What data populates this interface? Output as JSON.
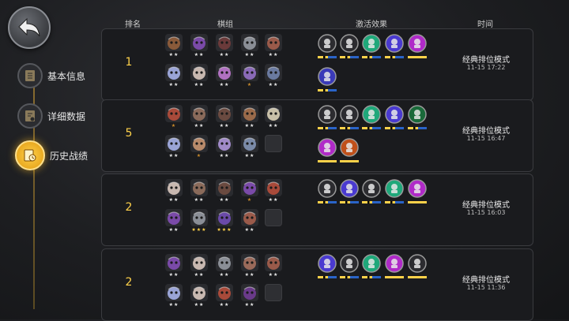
{
  "sidebar": [
    {
      "label": "基本信息",
      "icon": "notebook-icon",
      "active": false
    },
    {
      "label": "详细数据",
      "icon": "document-icon",
      "active": false
    },
    {
      "label": "历史战绩",
      "icon": "history-icon",
      "active": true
    }
  ],
  "headers": {
    "rank": "排名",
    "lineup": "棋组",
    "synergy": "激活效果",
    "time": "时间"
  },
  "colors": {
    "gold": "#ffd24a",
    "blue": "#2a64c8",
    "card_bg": "#1a1b1e"
  },
  "matches": [
    {
      "rank": "1",
      "mode": "经典排位模式",
      "time": "11-15 17:22",
      "heroes": [
        {
          "c": "#8a5a3a",
          "s": 2
        },
        {
          "c": "#7a4aa8",
          "s": 2
        },
        {
          "c": "#6a3a3a",
          "s": 2
        },
        {
          "c": "#8a8e96",
          "s": 2
        },
        {
          "c": "#9a5a4a",
          "s": 2
        },
        {
          "c": "#9aa4d6",
          "s": 2
        },
        {
          "c": "#c8b8b0",
          "s": 2
        },
        {
          "c": "#b070c0",
          "s": 2
        },
        {
          "c": "#8a6ab8",
          "s": 1
        },
        {
          "c": "#6a7aa0",
          "s": 2
        }
      ],
      "synergies": [
        {
          "icon": "axe-icon",
          "bg": "#2c2c30",
          "f": 1
        },
        {
          "icon": "helmet-icon",
          "bg": "#2c2c30",
          "f": 1
        },
        {
          "icon": "paw-icon",
          "bg": "#1fa87a",
          "f": 1
        },
        {
          "icon": "wizard-icon",
          "bg": "#4a3ad0",
          "f": 1
        },
        {
          "icon": "demon-icon",
          "bg": "#b02ac8",
          "f": 2
        },
        {
          "icon": "demon-icon",
          "bg": "#3a3ab8",
          "f": 1
        }
      ]
    },
    {
      "rank": "5",
      "mode": "经典排位模式",
      "time": "11-15 16:47",
      "heroes": [
        {
          "c": "#a84a3a",
          "s": 1
        },
        {
          "c": "#8a6a5a",
          "s": 2
        },
        {
          "c": "#6a4a40",
          "s": 2
        },
        {
          "c": "#9a6a4a",
          "s": 2
        },
        {
          "c": "#c8c0a8",
          "s": 2
        },
        {
          "c": "#9aa4d6",
          "s": 2
        },
        {
          "c": "#b88a6a",
          "s": 1
        },
        {
          "c": "#a08ac8",
          "s": 2
        },
        {
          "c": "#7a8aa8",
          "s": 2
        },
        {
          "c": "",
          "s": 0
        }
      ],
      "synergies": [
        {
          "icon": "helmet-icon",
          "bg": "#2c2c30",
          "f": 1
        },
        {
          "icon": "axe-icon",
          "bg": "#2c2c30",
          "f": 1
        },
        {
          "icon": "paw-icon",
          "bg": "#1fa87a",
          "f": 1
        },
        {
          "icon": "wizard-icon",
          "bg": "#4a3ad0",
          "f": 1
        },
        {
          "icon": "rune-icon",
          "bg": "#1a6a3a",
          "f": 1
        },
        {
          "icon": "demon-icon",
          "bg": "#b02ac8",
          "f": 2
        },
        {
          "icon": "ogre-icon",
          "bg": "#c0501a",
          "f": 2
        }
      ]
    },
    {
      "rank": "2",
      "mode": "经典排位模式",
      "time": "11-15 16:03",
      "heroes": [
        {
          "c": "#c8b8b0",
          "s": 2
        },
        {
          "c": "#8a6a5a",
          "s": 2
        },
        {
          "c": "#6a4a40",
          "s": 2
        },
        {
          "c": "#7a4aa8",
          "s": 1
        },
        {
          "c": "#a84a3a",
          "s": 2
        },
        {
          "c": "#7a4aa8",
          "s": 2
        },
        {
          "c": "#8a8e96",
          "s": 3
        },
        {
          "c": "#6a4aa8",
          "s": 3
        },
        {
          "c": "#9a5a4a",
          "s": 2
        },
        {
          "c": "",
          "s": 0
        }
      ],
      "synergies": [
        {
          "icon": "axe-icon",
          "bg": "#2c2c30",
          "f": 1
        },
        {
          "icon": "wizard-icon",
          "bg": "#4a3ad0",
          "f": 1
        },
        {
          "icon": "helmet-icon",
          "bg": "#2c2c30",
          "f": 1
        },
        {
          "icon": "paw-icon",
          "bg": "#1fa87a",
          "f": 1
        },
        {
          "icon": "demon-icon",
          "bg": "#b02ac8",
          "f": 2
        }
      ]
    },
    {
      "rank": "2",
      "mode": "经典排位模式",
      "time": "11-15 11:36",
      "heroes": [
        {
          "c": "#7a4aa8",
          "s": 2
        },
        {
          "c": "#c8b8b0",
          "s": 2
        },
        {
          "c": "#8a8e96",
          "s": 2
        },
        {
          "c": "#9a6a5a",
          "s": 2
        },
        {
          "c": "#9a5a4a",
          "s": 2
        },
        {
          "c": "#9aa4d6",
          "s": 2
        },
        {
          "c": "#c8b8b0",
          "s": 2
        },
        {
          "c": "#a84a3a",
          "s": 2
        },
        {
          "c": "#6a3a8a",
          "s": 2
        },
        {
          "c": "",
          "s": 0
        }
      ],
      "synergies": [
        {
          "icon": "wizard-icon",
          "bg": "#4a3ad0",
          "f": 1
        },
        {
          "icon": "axe-icon",
          "bg": "#2c2c30",
          "f": 1
        },
        {
          "icon": "paw-icon",
          "bg": "#1fa87a",
          "f": 1
        },
        {
          "icon": "demon-icon",
          "bg": "#b02ac8",
          "f": 2
        },
        {
          "icon": "helmet-icon",
          "bg": "#2c2c30",
          "f": 2
        }
      ]
    }
  ]
}
